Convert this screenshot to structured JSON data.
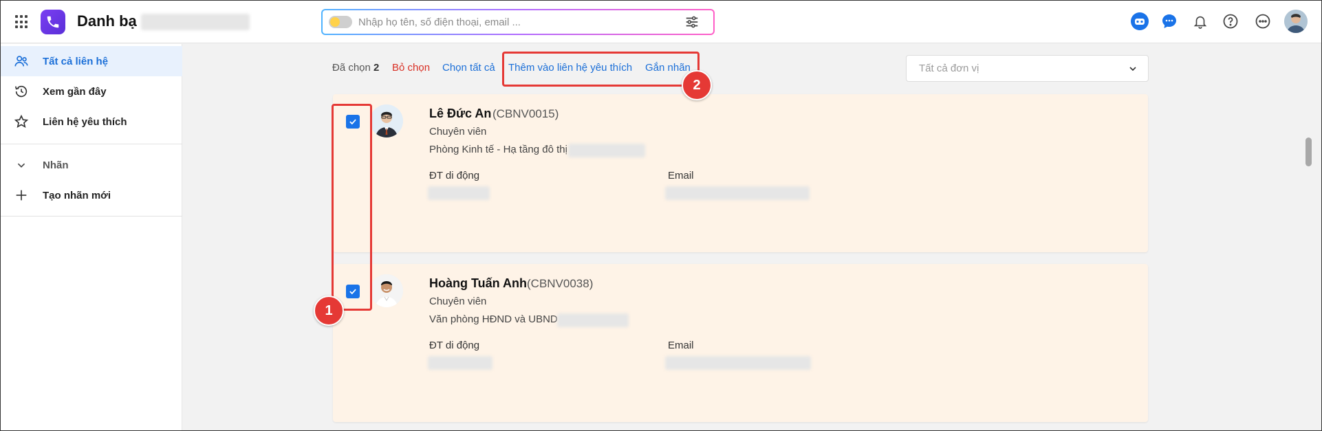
{
  "header": {
    "app_title": "Danh bạ",
    "search_placeholder": "Nhập họ tên, số điện thoại, email ...",
    "icons": [
      "apps-grid-icon",
      "app-logo-icon",
      "ai-toggle-icon",
      "filter-sliders-icon",
      "bot-icon",
      "chat-icon",
      "bell-icon",
      "help-icon",
      "more-icon",
      "user-avatar"
    ]
  },
  "sidebar": {
    "items": [
      {
        "label": "Tất cả liên hệ",
        "icon": "contacts-icon",
        "active": true
      },
      {
        "label": "Xem gần đây",
        "icon": "history-icon"
      },
      {
        "label": "Liên hệ yêu thích",
        "icon": "star-icon"
      }
    ],
    "labels_section": {
      "title": "Nhãn",
      "create_label": "Tạo nhãn mới"
    }
  },
  "toolbar": {
    "selected_text": "Đã chọn",
    "selected_count": "2",
    "clear_label": "Bỏ chọn",
    "select_all_label": "Chọn tất cả",
    "add_favorite_label": "Thêm vào liên hệ yêu thích",
    "attach_label": "Gắn nhãn",
    "unit_select": "Tất cả đơn vị"
  },
  "contacts": [
    {
      "name": "Lê Đức An",
      "code": "(CBNV0015)",
      "role": "Chuyên viên",
      "dept": "Phòng Kinh tế - Hạ tầng đô thị",
      "phone_label": "ĐT di động",
      "email_label": "Email",
      "checked": true
    },
    {
      "name": "Hoàng Tuấn Anh",
      "code": "(CBNV0038)",
      "role": "Chuyên viên",
      "dept": "Văn phòng HĐND và UBND",
      "phone_label": "ĐT di động",
      "email_label": "Email",
      "checked": true
    }
  ],
  "annotations": {
    "badge_1": "1",
    "badge_2": "2"
  },
  "colors": {
    "accent": "#1b6fd8",
    "danger": "#d93025",
    "card_bg": "#fef3e7",
    "annotation": "#e53935",
    "active_nav_bg": "#e8f1fd"
  }
}
